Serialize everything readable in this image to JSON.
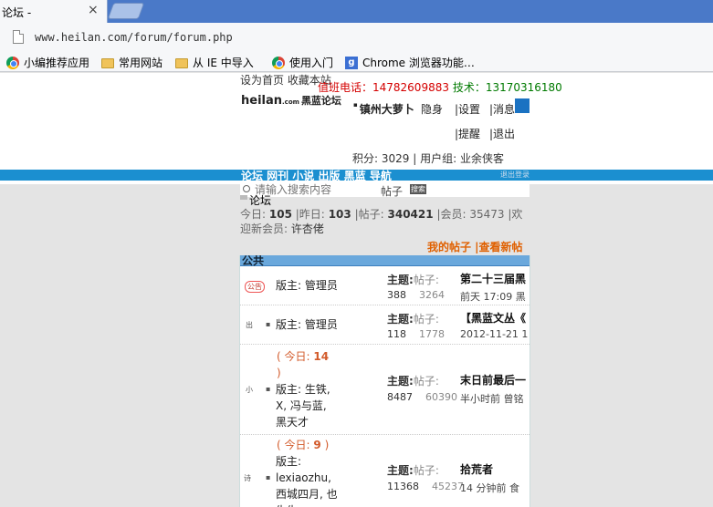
{
  "browser": {
    "tab_title": "论坛 -",
    "tab_close": "×",
    "url": "www.heilan.com/forum/forum.php",
    "bookmarks": [
      {
        "icon": "chrome-icon",
        "label": "小编推荐应用"
      },
      {
        "icon": "folder-icon",
        "label": "常用网站"
      },
      {
        "icon": "folder-icon",
        "label": "从 IE 中导入"
      },
      {
        "icon": "chrome-icon",
        "label": "使用入门"
      },
      {
        "icon": "google-icon",
        "label": "Chrome 浏览器功能…"
      }
    ]
  },
  "header": {
    "top_note": "设为首页 收藏本站",
    "phone_label": "值班电话：14782609883",
    "tech_label": "技术：13170316180",
    "logo_main": "heilan",
    "logo_com": ".com",
    "logo_cn": "黑蓝论坛"
  },
  "user": {
    "name": "镇州大萝卜",
    "links": {
      "hide": "隐身",
      "settings": "|设置",
      "messages": "|消息",
      "remind": "|提醒",
      "logout": "|退出"
    },
    "credits": "积分: 3029",
    "group": "| 用户组: 业余侠客"
  },
  "nav": {
    "items": "论坛 网刊 小说 出版 黑蓝 导航",
    "right": "退出登录"
  },
  "search": {
    "placeholder": "请输入搜索内容",
    "type": "帖子",
    "button": "搜索"
  },
  "breadcrumb": "论坛",
  "stats": {
    "today_label": "今日:",
    "today": "105",
    "yesterday_label": "|昨日:",
    "yesterday": "103",
    "posts_label": "|帖子:",
    "posts": "340421",
    "members_label": "|会员:",
    "members": "35473",
    "tail": "|欢",
    "welcome_label": "迎新会员:",
    "newest": "许杏佬"
  },
  "my_links": "我的帖子 |查看新帖",
  "category": {
    "title": "公共",
    "rows": [
      {
        "icon": "公告",
        "today": "",
        "moderator": "版主: 管理员",
        "topics_label": "主题:",
        "posts_label": "帖子:",
        "topics": "388",
        "posts": "3264",
        "last_title": "第二十三届黑",
        "last_time": "前天 17:09 黑"
      },
      {
        "icon": "出",
        "today": "",
        "moderator": "版主: 管理员",
        "topics_label": "主题:",
        "posts_label": "帖子:",
        "topics": "118",
        "posts": "1778",
        "last_title": "【黑蓝文丛《",
        "last_time": "2012-11-21 1"
      },
      {
        "icon": "小",
        "today_prefix": "( 今日:",
        "today": "14",
        "today_suffix": ")",
        "moderator_lines": [
          "版主: 生铁,",
          "X, 冯与蓝,",
          "黑天才"
        ],
        "topics_label": "主题:",
        "posts_label": "帖子:",
        "topics": "8487",
        "posts": "60390",
        "last_title": "末日前最后一",
        "last_time": "半小时前 曾铭"
      },
      {
        "icon": "诗",
        "today_prefix": "( 今日:",
        "today": "9",
        "today_suffix": ")",
        "moderator_lines": [
          "版主:",
          "lexiaozhu,",
          "西城四月, 也",
          "生生"
        ],
        "topics_label": "主题:",
        "posts_label": "帖子:",
        "topics": "11368",
        "posts": "45237",
        "last_title": "拾荒者",
        "last_time": "14 分钟前 食"
      }
    ]
  }
}
